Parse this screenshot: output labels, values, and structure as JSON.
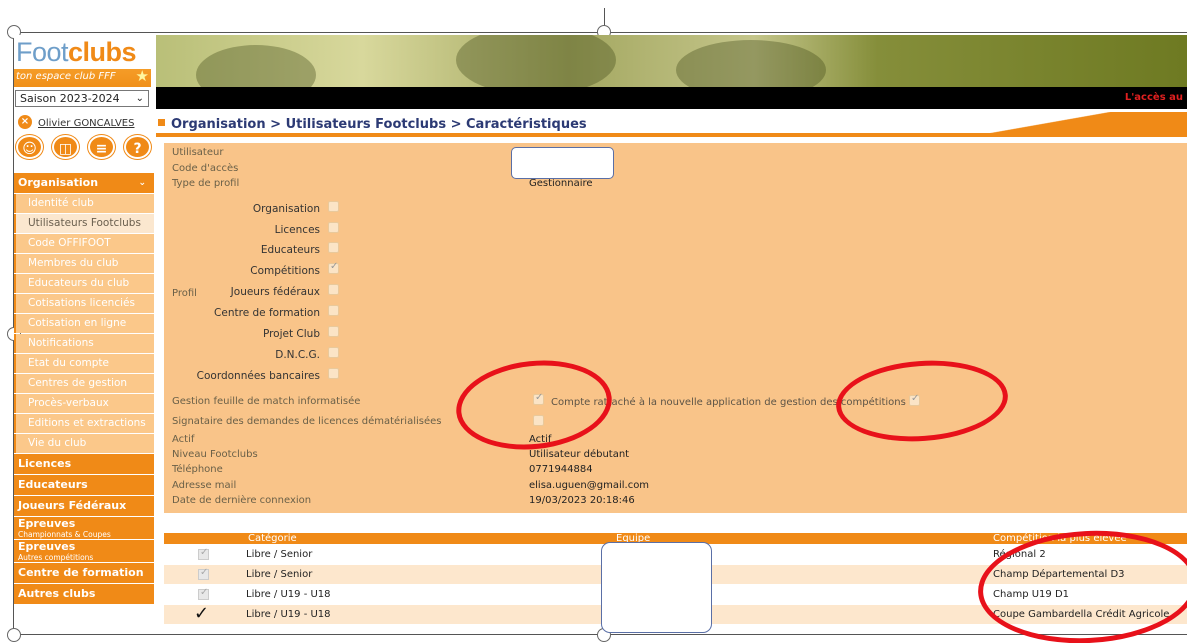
{
  "logo": {
    "foot": "Foot",
    "clubs": "clubs",
    "subtitle": "ton espace club FFF",
    "star": "★"
  },
  "header": {
    "banner_alert": "L'accès au"
  },
  "season": {
    "value": "Saison 2023-2024",
    "caret": "⌄"
  },
  "user": {
    "icon": "close-x",
    "name": "Olivier GONCALVES"
  },
  "quick_icons": [
    "group-icon",
    "document-icon",
    "list-icon",
    "help-icon"
  ],
  "sidebar": {
    "section": "Organisation",
    "items": [
      {
        "label": "Identité club",
        "active": false
      },
      {
        "label": "Utilisateurs Footclubs",
        "active": true
      },
      {
        "label": "Code OFFIFOOT",
        "active": false
      },
      {
        "label": "Membres du club",
        "active": false
      },
      {
        "label": "Educateurs du club",
        "active": false
      },
      {
        "label": "Cotisations licenciés",
        "active": false
      },
      {
        "label": "Cotisation en ligne",
        "active": false
      },
      {
        "label": "Notifications",
        "active": false
      },
      {
        "label": "Etat du compte",
        "active": false
      },
      {
        "label": "Centres de gestion",
        "active": false
      },
      {
        "label": "Procès-verbaux",
        "active": false
      },
      {
        "label": "Editions et extractions",
        "active": false
      },
      {
        "label": "Vie du club",
        "active": false
      }
    ],
    "main": [
      "Licences",
      "Educateurs",
      "Joueurs Fédéraux"
    ],
    "epreuves1": {
      "label": "Epreuves",
      "sub": "Championnats & Coupes"
    },
    "epreuves2": {
      "label": "Epreuves",
      "sub": "Autres compétitions"
    },
    "tail": [
      "Centre de formation",
      "Autres clubs"
    ]
  },
  "page": {
    "title": "Organisation > Utilisateurs Footclubs > Caractéristiques"
  },
  "form": {
    "utilisateur_label": "Utilisateur",
    "code_label": "Code d'accès",
    "type_label": "Type de profil",
    "type_value": "Gestionnaire",
    "profil_label": "Profil",
    "profile_rights": [
      {
        "label": "Organisation",
        "checked": false
      },
      {
        "label": "Licences",
        "checked": false
      },
      {
        "label": "Educateurs",
        "checked": false
      },
      {
        "label": "Compétitions",
        "checked": true
      },
      {
        "label": "Joueurs fédéraux",
        "checked": false
      },
      {
        "label": "Centre de formation",
        "checked": false
      },
      {
        "label": "Projet Club",
        "checked": false
      },
      {
        "label": "D.N.C.G.",
        "checked": false
      },
      {
        "label": "Coordonnées bancaires",
        "checked": false
      }
    ],
    "gestion_label": "Gestion feuille de match informatisée",
    "compte_text": "Compte rattaché à la nouvelle application de gestion des compétitions",
    "signataire_label": "Signataire des demandes de licences dématérialisées",
    "actif_label": "Actif",
    "actif_value": "Actif",
    "niveau_label": "Niveau Footclubs",
    "niveau_value": "Utilisateur débutant",
    "tel_label": "Téléphone",
    "tel_value": "0771944884",
    "mail_label": "Adresse mail",
    "mail_value": "elisa.uguen@gmail.com",
    "last_label": "Date de dernière connexion",
    "last_value": "19/03/2023 20:18:46"
  },
  "table": {
    "headers": {
      "categorie": "Catégorie",
      "equipe": "Equipe",
      "competition": "Compétition la plus élevée"
    },
    "rows": [
      {
        "categorie": "Libre / Senior",
        "competition": "Régional 2",
        "mark": "checkbox"
      },
      {
        "categorie": "Libre / Senior",
        "competition": "Champ Départemental D3",
        "mark": "checkbox"
      },
      {
        "categorie": "Libre / U19 - U18",
        "competition": "Champ U19 D1",
        "mark": "checkbox"
      },
      {
        "categorie": "Libre / U19 - U18",
        "competition": "Coupe Gambardella Crédit Agricole",
        "mark": "check"
      }
    ]
  },
  "colors": {
    "accent": "#f08a17",
    "panel": "#f9c489",
    "title": "#2c3a74",
    "annotation": "#e8111a"
  }
}
